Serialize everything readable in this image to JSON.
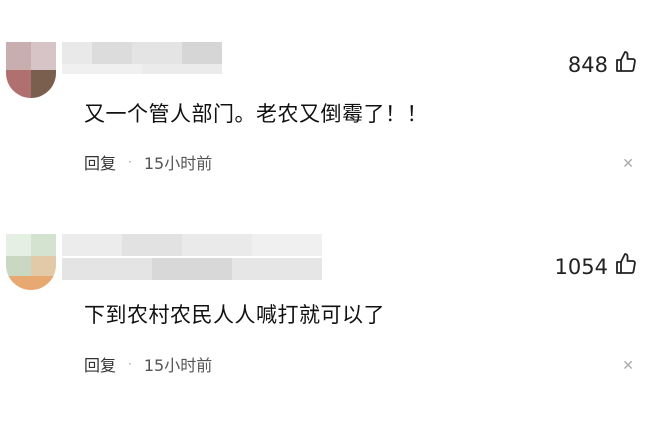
{
  "comments": [
    {
      "likes": "848",
      "text": "又一个管人部门。老农又倒霉了！！",
      "reply": "回复",
      "time": "15小时前"
    },
    {
      "likes": "1054",
      "text": "下到农村农民人人喊打就可以了",
      "reply": "回复",
      "time": "15小时前"
    }
  ],
  "icons": {
    "like": "thumbs-up-icon",
    "close": "close-icon"
  },
  "colors": {
    "text": "#111111",
    "meta": "#555555",
    "close": "#aaaaaa"
  }
}
